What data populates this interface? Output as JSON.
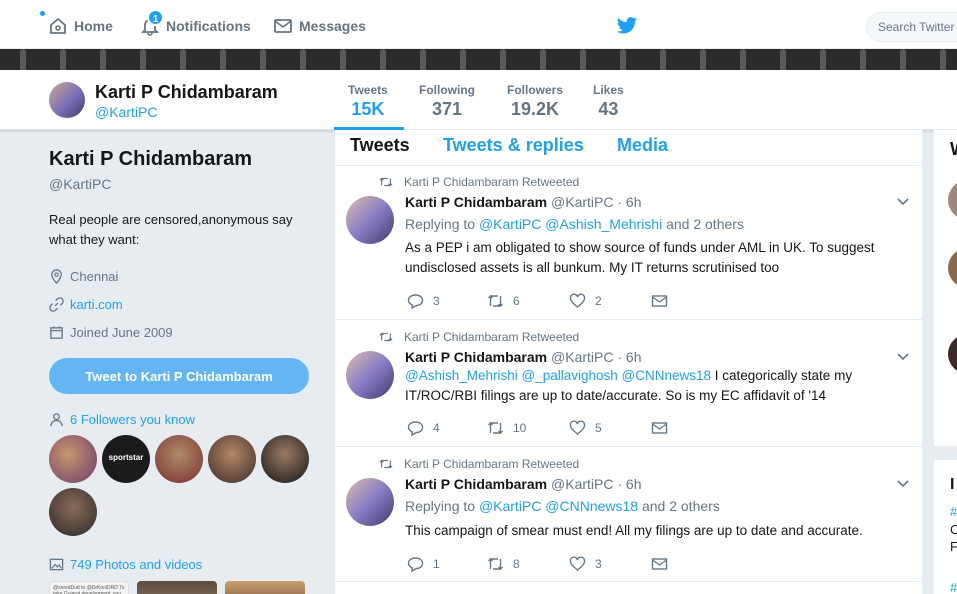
{
  "nav": {
    "home": "Home",
    "notifications": "Notifications",
    "notifications_count": "1",
    "messages": "Messages",
    "search_placeholder": "Search Twitter"
  },
  "profile": {
    "name": "Karti P Chidambaram",
    "handle": "@KartiPC",
    "bio": "Real people are censored,anonymous say what they want:",
    "location": "Chennai",
    "website": "karti.com",
    "joined": "Joined June 2009",
    "tweet_to_label": "Tweet to Karti P Chidambaram",
    "followers_you_know": "6 Followers you know",
    "photos_videos": "749 Photos and videos"
  },
  "stats": [
    {
      "label": "Tweets",
      "value": "15K"
    },
    {
      "label": "Following",
      "value": "371"
    },
    {
      "label": "Followers",
      "value": "19.2K"
    },
    {
      "label": "Likes",
      "value": "43"
    }
  ],
  "tabs": [
    "Tweets",
    "Tweets & replies",
    "Media"
  ],
  "tweets": [
    {
      "retweet_label": "Karti P Chidambaram Retweeted",
      "name": "Karti P Chidambaram",
      "handle_time": "@KartiPC · 6h",
      "replying_prefix": "Replying to",
      "replying_mentions": "@KartiPC @Ashish_Mehrishi",
      "replying_suffix": "and 2 others",
      "text": "As a PEP i am obligated to show source of funds under AML in UK. To suggest undisclosed assets is all bunkum. My IT returns scrutinised too",
      "replies": "3",
      "retweets": "6",
      "likes": "2"
    },
    {
      "retweet_label": "Karti P Chidambaram Retweeted",
      "name": "Karti P Chidambaram",
      "handle_time": "@KartiPC · 6h",
      "text_mentions": "@Ashish_Mehrishi @_pallavighosh @CNNnews18",
      "text": "I categorically state my IT/ROC/RBI filings are up to date/accurate. So is my EC affidavit of '14",
      "replies": "4",
      "retweets": "10",
      "likes": "5"
    },
    {
      "retweet_label": "Karti P Chidambaram Retweeted",
      "name": "Karti P Chidambaram",
      "handle_time": "@KartiPC · 6h",
      "replying_prefix": "Replying to",
      "replying_mentions": "@KartiPC @CNNnews18",
      "replying_suffix": "and 2 others",
      "text": "This campaign of smear must end! All my filings are up to date and accurate.",
      "replies": "1",
      "retweets": "8",
      "likes": "3"
    }
  ],
  "right": {
    "heading_fragment": "W",
    "section2_fragment": "I",
    "link_fragment_1": "#",
    "text_fragment_1": "C",
    "text_fragment_2": "F",
    "link_fragment_2": "#"
  },
  "follower_avatar_text": "sportstar",
  "thumb_text": "@sreedDutt to @DrKoolDRD To take Gujarat development, you need to wear Gujarati glasses and not ones with Italian",
  "colors": {
    "accent": "#1da1f2",
    "button": "#63b6f1",
    "muted": "#657786",
    "background": "#e6ecf0"
  }
}
